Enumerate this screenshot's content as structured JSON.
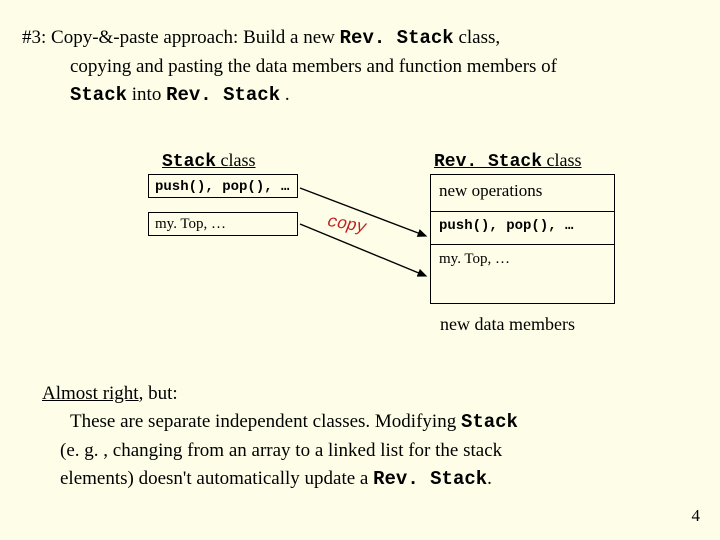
{
  "intro": {
    "prefix": "#3: Copy-&-paste approach:   Build a new ",
    "code1": "Rev. Stack",
    "after1": " class,",
    "line2a": "copying and pasting the data members and function members of ",
    "line3code1": "Stack",
    "line3mid": " into ",
    "line3code2": "Rev. Stack",
    "line3end": " ."
  },
  "diagram": {
    "left_title_code": "Stack",
    "left_title_tail": " class",
    "right_title_code": "Rev. Stack",
    "right_title_tail": " class",
    "left_box1": "push(), pop(), …",
    "left_box2": "my. Top, …",
    "right_row1": "new operations",
    "right_row2": "push(), pop(), …",
    "right_row3": "my. Top, …",
    "new_data": "new data members",
    "copy_label": "copy"
  },
  "conclusion": {
    "lead": "Almost right",
    "lead_tail": ", but:",
    "body1a": " These are separate independent classes.  Modifying ",
    "body1code": "Stack",
    "body2": "(e. g. , changing from an array to a linked list for the stack",
    "body3a": "elements) doesn't automatically update a ",
    "body3code": "Rev. Stack",
    "body3tail": "."
  },
  "pagenum": "4"
}
